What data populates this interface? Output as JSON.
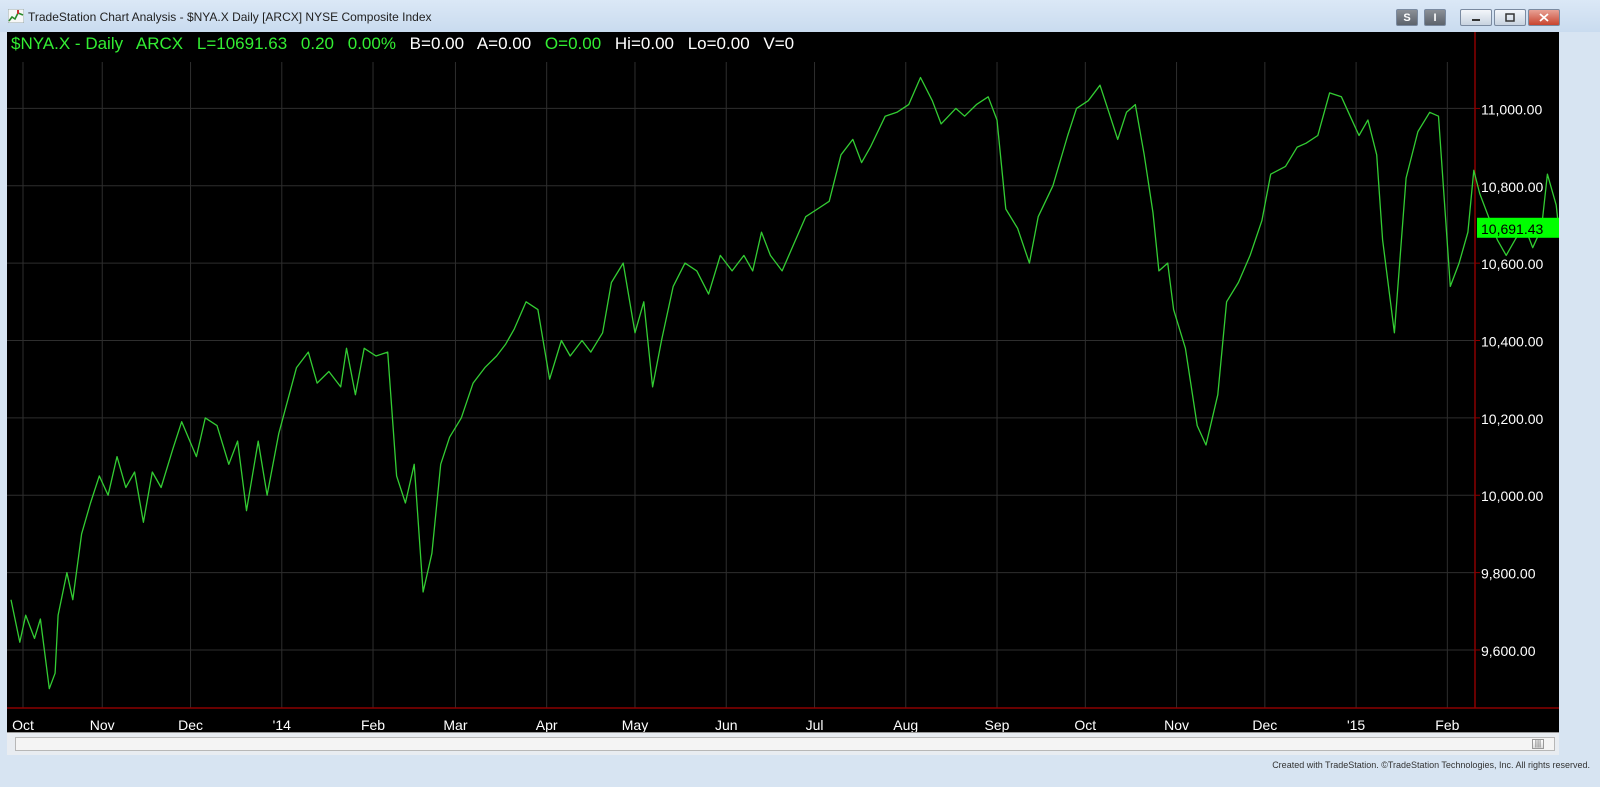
{
  "window": {
    "title": "TradeStation Chart Analysis - $NYA.X Daily [ARCX] NYSE Composite Index",
    "buttons": [
      "S",
      "I"
    ]
  },
  "header": {
    "symbol": "$NYA.X - Daily",
    "exchange": "ARCX",
    "last": "L=10691.63",
    "change": "0.20",
    "pct": "0.00%",
    "bid": "B=0.00",
    "ask": "A=0.00",
    "open": "O=0.00",
    "high": "Hi=0.00",
    "low": "Lo=0.00",
    "volume": "V=0"
  },
  "footer": "Created with TradeStation. ©TradeStation Technologies, Inc. All rights reserved.",
  "colors": {
    "line": "#33cc33",
    "background": "#000000",
    "axis": "#8b0000",
    "last_price_tag": "#00ff00"
  },
  "chart_data": {
    "type": "line",
    "x_ticks": [
      "Oct",
      "Nov",
      "Dec",
      "'14",
      "Feb",
      "Mar",
      "Apr",
      "May",
      "Jun",
      "Jul",
      "Aug",
      "Sep",
      "Oct",
      "Nov",
      "Dec",
      "'15",
      "Feb"
    ],
    "y_ticks": [
      "11,000.00",
      "10,800.00",
      "10,600.00",
      "10,400.00",
      "10,200.00",
      "10,000.00",
      "9,800.00",
      "9,600.00"
    ],
    "ylim": [
      9450,
      11120
    ],
    "last_price_label": "10,691.43",
    "last_value": 10691.43,
    "x_range": [
      "2013-10-01",
      "2015-02-07"
    ],
    "series": [
      {
        "points": [
          [
            "2013-10-01",
            9730
          ],
          [
            "2013-10-04",
            9620
          ],
          [
            "2013-10-06",
            9690
          ],
          [
            "2013-10-09",
            9630
          ],
          [
            "2013-10-11",
            9680
          ],
          [
            "2013-10-14",
            9500
          ],
          [
            "2013-10-16",
            9540
          ],
          [
            "2013-10-17",
            9690
          ],
          [
            "2013-10-20",
            9800
          ],
          [
            "2013-10-22",
            9730
          ],
          [
            "2013-10-25",
            9900
          ],
          [
            "2013-10-28",
            9980
          ],
          [
            "2013-10-31",
            10050
          ],
          [
            "2013-11-03",
            10000
          ],
          [
            "2013-11-06",
            10100
          ],
          [
            "2013-11-09",
            10020
          ],
          [
            "2013-11-12",
            10060
          ],
          [
            "2013-11-15",
            9930
          ],
          [
            "2013-11-18",
            10060
          ],
          [
            "2013-11-21",
            10020
          ],
          [
            "2013-11-25",
            10120
          ],
          [
            "2013-11-28",
            10190
          ],
          [
            "2013-12-03",
            10100
          ],
          [
            "2013-12-06",
            10200
          ],
          [
            "2013-12-10",
            10180
          ],
          [
            "2013-12-14",
            10080
          ],
          [
            "2013-12-17",
            10140
          ],
          [
            "2013-12-20",
            9960
          ],
          [
            "2013-12-24",
            10140
          ],
          [
            "2013-12-27",
            10000
          ],
          [
            "2013-12-31",
            10160
          ],
          [
            "2014-01-06",
            10330
          ],
          [
            "2014-01-10",
            10370
          ],
          [
            "2014-01-13",
            10290
          ],
          [
            "2014-01-17",
            10320
          ],
          [
            "2014-01-21",
            10280
          ],
          [
            "2014-01-23",
            10380
          ],
          [
            "2014-01-26",
            10260
          ],
          [
            "2014-01-29",
            10380
          ],
          [
            "2014-02-02",
            10360
          ],
          [
            "2014-02-06",
            10370
          ],
          [
            "2014-02-09",
            10050
          ],
          [
            "2014-02-12",
            9980
          ],
          [
            "2014-02-15",
            10080
          ],
          [
            "2014-02-18",
            9750
          ],
          [
            "2014-02-21",
            9850
          ],
          [
            "2014-02-24",
            10080
          ],
          [
            "2014-02-27",
            10150
          ],
          [
            "2014-03-03",
            10200
          ],
          [
            "2014-03-07",
            10290
          ],
          [
            "2014-03-11",
            10330
          ],
          [
            "2014-03-15",
            10360
          ],
          [
            "2014-03-18",
            10390
          ],
          [
            "2014-03-21",
            10430
          ],
          [
            "2014-03-25",
            10500
          ],
          [
            "2014-03-29",
            10480
          ],
          [
            "2014-04-02",
            10300
          ],
          [
            "2014-04-06",
            10400
          ],
          [
            "2014-04-09",
            10360
          ],
          [
            "2014-04-13",
            10400
          ],
          [
            "2014-04-16",
            10370
          ],
          [
            "2014-04-20",
            10420
          ],
          [
            "2014-04-23",
            10550
          ],
          [
            "2014-04-27",
            10600
          ],
          [
            "2014-05-01",
            10420
          ],
          [
            "2014-05-04",
            10500
          ],
          [
            "2014-05-07",
            10280
          ],
          [
            "2014-05-10",
            10400
          ],
          [
            "2014-05-14",
            10540
          ],
          [
            "2014-05-18",
            10600
          ],
          [
            "2014-05-22",
            10580
          ],
          [
            "2014-05-26",
            10520
          ],
          [
            "2014-05-30",
            10620
          ],
          [
            "2014-06-03",
            10580
          ],
          [
            "2014-06-07",
            10620
          ],
          [
            "2014-06-10",
            10580
          ],
          [
            "2014-06-13",
            10680
          ],
          [
            "2014-06-16",
            10620
          ],
          [
            "2014-06-20",
            10580
          ],
          [
            "2014-06-24",
            10650
          ],
          [
            "2014-06-28",
            10720
          ],
          [
            "2014-07-02",
            10740
          ],
          [
            "2014-07-06",
            10760
          ],
          [
            "2014-07-10",
            10880
          ],
          [
            "2014-07-14",
            10920
          ],
          [
            "2014-07-17",
            10860
          ],
          [
            "2014-07-20",
            10900
          ],
          [
            "2014-07-25",
            10980
          ],
          [
            "2014-07-29",
            10990
          ],
          [
            "2014-08-02",
            11010
          ],
          [
            "2014-08-06",
            11080
          ],
          [
            "2014-08-10",
            11020
          ],
          [
            "2014-08-13",
            10960
          ],
          [
            "2014-08-18",
            11000
          ],
          [
            "2014-08-21",
            10980
          ],
          [
            "2014-08-25",
            11010
          ],
          [
            "2014-08-29",
            11030
          ],
          [
            "2014-09-01",
            10970
          ],
          [
            "2014-09-04",
            10740
          ],
          [
            "2014-09-08",
            10690
          ],
          [
            "2014-09-12",
            10600
          ],
          [
            "2014-09-15",
            10720
          ],
          [
            "2014-09-20",
            10800
          ],
          [
            "2014-09-25",
            10930
          ],
          [
            "2014-09-28",
            11000
          ],
          [
            "2014-10-02",
            11020
          ],
          [
            "2014-10-06",
            11060
          ],
          [
            "2014-10-09",
            10990
          ],
          [
            "2014-10-12",
            10920
          ],
          [
            "2014-10-15",
            10990
          ],
          [
            "2014-10-18",
            11010
          ],
          [
            "2014-10-21",
            10880
          ],
          [
            "2014-10-24",
            10730
          ],
          [
            "2014-10-26",
            10580
          ],
          [
            "2014-10-29",
            10600
          ],
          [
            "2014-10-31",
            10480
          ],
          [
            "2014-11-04",
            10380
          ],
          [
            "2014-11-08",
            10180
          ],
          [
            "2014-11-11",
            10130
          ],
          [
            "2014-11-15",
            10260
          ],
          [
            "2014-11-18",
            10500
          ],
          [
            "2014-11-22",
            10550
          ],
          [
            "2014-11-26",
            10620
          ],
          [
            "2014-11-30",
            10710
          ],
          [
            "2014-12-03",
            10830
          ],
          [
            "2014-12-08",
            10850
          ],
          [
            "2014-12-12",
            10900
          ],
          [
            "2014-12-15",
            10910
          ],
          [
            "2014-12-19",
            10930
          ],
          [
            "2014-12-23",
            11040
          ],
          [
            "2014-12-27",
            11030
          ],
          [
            "2014-12-30",
            10980
          ],
          [
            "2015-01-02",
            10930
          ],
          [
            "2015-01-05",
            10970
          ],
          [
            "2015-01-08",
            10880
          ],
          [
            "2015-01-10",
            10660
          ],
          [
            "2015-01-14",
            10420
          ],
          [
            "2015-01-18",
            10820
          ],
          [
            "2015-01-22",
            10940
          ],
          [
            "2015-01-26",
            10990
          ],
          [
            "2015-01-29",
            10980
          ],
          [
            "2015-01-31",
            10760
          ],
          [
            "2015-02-02",
            10540
          ],
          [
            "2015-02-05",
            10600
          ],
          [
            "2015-02-08",
            10680
          ],
          [
            "2015-02-10",
            10840
          ],
          [
            "2015-02-12",
            10780
          ],
          [
            "2015-02-15",
            10720
          ],
          [
            "2015-02-18",
            10660
          ],
          [
            "2015-02-21",
            10620
          ],
          [
            "2015-02-24",
            10660
          ],
          [
            "2015-02-27",
            10700
          ],
          [
            "2015-03-02",
            10640
          ],
          [
            "2015-03-05",
            10690
          ],
          [
            "2015-03-07",
            10830
          ],
          [
            "2015-03-10",
            10750
          ],
          [
            "2015-03-12",
            10610
          ],
          [
            "2015-03-15",
            10691
          ]
        ]
      }
    ]
  }
}
